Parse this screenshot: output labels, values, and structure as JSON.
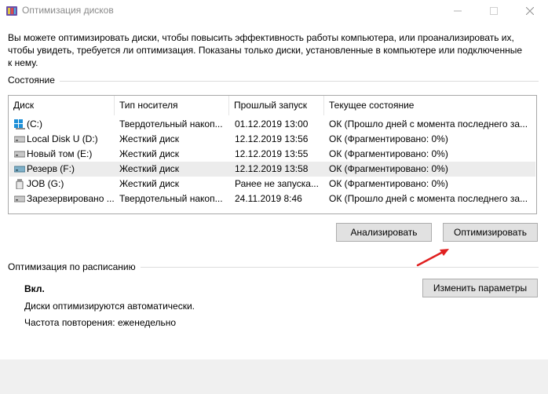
{
  "window": {
    "title": "Оптимизация дисков",
    "app_icon": "defrag-icon"
  },
  "intro": {
    "text": "Вы можете оптимизировать диски, чтобы повысить эффективность работы  компьютера, или проанализировать их, чтобы увидеть, требуется ли оптимизация. Показаны только диски, установленные в компьютере или подключенные к нему."
  },
  "status_section": {
    "label": "Состояние"
  },
  "drives": {
    "columns": [
      "Диск",
      "Тип носителя",
      "Прошлый запуск",
      "Текущее состояние"
    ],
    "rows": [
      {
        "name": "(C:)",
        "type": "Твердотельный накоп...",
        "last_run": "01.12.2019 13:00",
        "status": "ОК (Прошло дней с момента последнего за...",
        "icon": "system-drive-icon",
        "selected": false
      },
      {
        "name": "Local Disk U (D:)",
        "type": "Жесткий диск",
        "last_run": "12.12.2019 13:56",
        "status": "ОК (Фрагментировано: 0%)",
        "icon": "hard-drive-icon",
        "selected": false
      },
      {
        "name": "Новый том (E:)",
        "type": "Жесткий диск",
        "last_run": "12.12.2019 13:55",
        "status": "ОК (Фрагментировано: 0%)",
        "icon": "hard-drive-icon",
        "selected": false
      },
      {
        "name": "Резерв (F:)",
        "type": "Жесткий диск",
        "last_run": "12.12.2019 13:58",
        "status": "ОК (Фрагментировано: 0%)",
        "icon": "hard-drive-icon",
        "selected": true
      },
      {
        "name": "JOB (G:)",
        "type": "Жесткий диск",
        "last_run": "Ранее не запуска...",
        "status": "ОК (Фрагментировано: 0%)",
        "icon": "usb-drive-icon",
        "selected": false
      },
      {
        "name": "Зарезервировано ...",
        "type": "Твердотельный накоп...",
        "last_run": "24.11.2019 8:46",
        "status": "ОК (Прошло дней с момента последнего за...",
        "icon": "hard-drive-icon",
        "selected": false
      }
    ]
  },
  "actions": {
    "analyze_label": "Анализировать",
    "optimize_label": "Оптимизировать"
  },
  "schedule": {
    "label": "Оптимизация по расписанию",
    "status": "Вкл.",
    "auto_text": "Диски оптимизируются автоматически.",
    "frequency_text": "Частота повторения: еженедельно",
    "change_label": "Изменить параметры"
  },
  "colors": {
    "accent_arrow": "#e02020",
    "selected_row": "#ececec",
    "button_bg": "#e1e1e1",
    "title_text": "#8a8a8a"
  }
}
